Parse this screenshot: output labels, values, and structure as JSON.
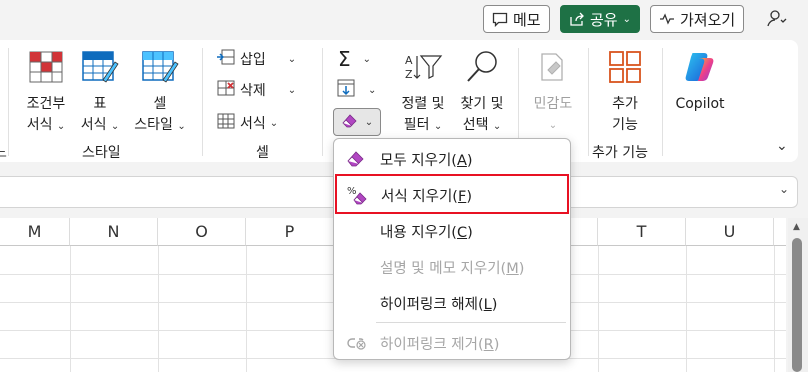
{
  "topbar": {
    "memo_label": "메모",
    "share_label": "공유",
    "get_addins_label": "가져오기"
  },
  "ribbon": {
    "styles": {
      "conditional_format": [
        "조건부",
        "서식"
      ],
      "table_format": [
        "표",
        "서식"
      ],
      "cell_style": [
        "셀",
        "스타일"
      ],
      "group_label": "스타일"
    },
    "cells": {
      "insert": "삽입",
      "delete": "삭제",
      "format": "서식",
      "group_label": "셀"
    },
    "editing": {
      "sort_filter": [
        "정렬 및",
        "필터"
      ],
      "find_select": [
        "찾기 및",
        "선택"
      ],
      "sigma": "Σ"
    },
    "sensitivity": {
      "label": "민감도"
    },
    "addins": {
      "label": [
        "추가",
        "기능"
      ],
      "group_label": "추가 기능"
    },
    "copilot": {
      "label": "Copilot"
    },
    "partial_group_label": "느"
  },
  "grid": {
    "columns": [
      "M",
      "N",
      "O",
      "P",
      "T",
      "U"
    ]
  },
  "menu": {
    "items": [
      {
        "label": "모두 지우기(",
        "key": "A",
        "close": ")",
        "enabled": true
      },
      {
        "label": "서식 지우기(",
        "key": "F",
        "close": ")",
        "enabled": true,
        "highlighted": true
      },
      {
        "label": "내용 지우기(",
        "key": "C",
        "close": ")",
        "enabled": true
      },
      {
        "label": "설명 및 메모 지우기(",
        "key": "M",
        "close": ")",
        "enabled": false
      },
      {
        "label": "하이퍼링크 해제(",
        "key": "L",
        "close": ")",
        "enabled": true
      },
      {
        "label": "하이퍼링크 제거(",
        "key": "R",
        "close": ")",
        "enabled": false
      }
    ]
  },
  "colors": {
    "share_green": "#1e7145",
    "highlight_red": "#e81123",
    "eraser_purple": "#b146c2"
  }
}
